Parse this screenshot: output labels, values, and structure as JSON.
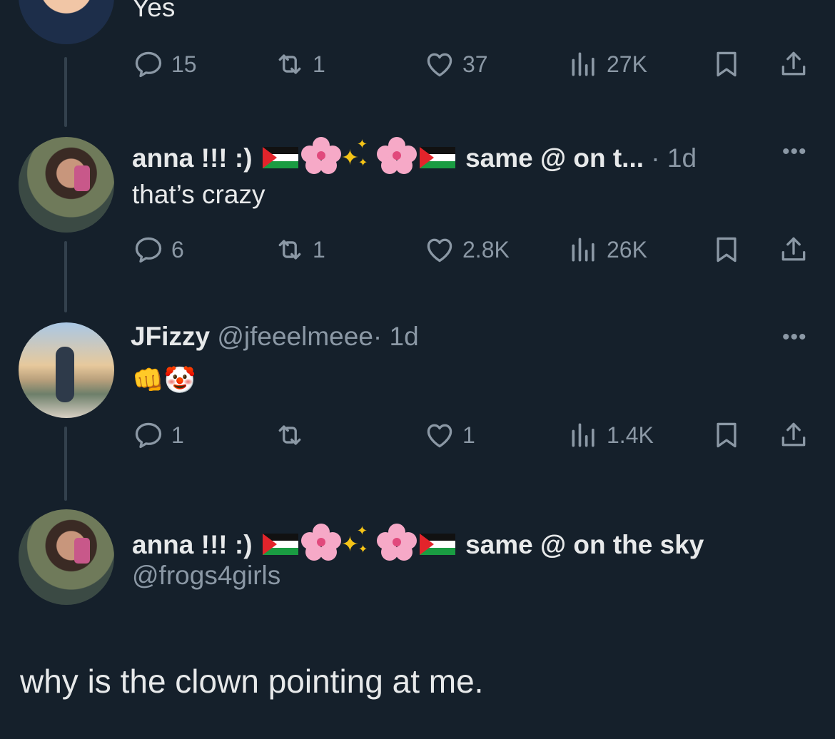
{
  "top_tweet": {
    "text": "Yes",
    "actions": {
      "replies": "15",
      "reposts": "1",
      "likes": "37",
      "views": "27K"
    }
  },
  "tweet1": {
    "name": "anna !!! :)",
    "name_suffix": "same @ on t...",
    "meta": "· 1d",
    "text": "that’s crazy",
    "more": "•••",
    "actions": {
      "replies": "6",
      "reposts": "1",
      "likes": "2.8K",
      "views": "26K"
    }
  },
  "tweet2": {
    "name": "JFizzy",
    "handle": "@jfeeelmeee",
    "meta": "· 1d",
    "text": "👊🤡",
    "more": "•••",
    "actions": {
      "replies": "1",
      "reposts": "",
      "likes": "1",
      "views": "1.4K"
    }
  },
  "reply_compose": {
    "name": "anna !!! :)",
    "name_suffix": "same @ on the sky",
    "handle": "@frogs4girls"
  },
  "caption": "why is the clown pointing at me.",
  "icons": {
    "reply": "comment-bubble-icon",
    "repost": "repost-arrows-icon",
    "like": "heart-icon",
    "views": "bar-chart-icon",
    "bookmark": "bookmark-icon",
    "share": "share-upload-icon"
  },
  "colors": {
    "background": "#15202b",
    "text": "#e7e9ea",
    "muted": "#8b98a5",
    "line": "#33414d"
  }
}
